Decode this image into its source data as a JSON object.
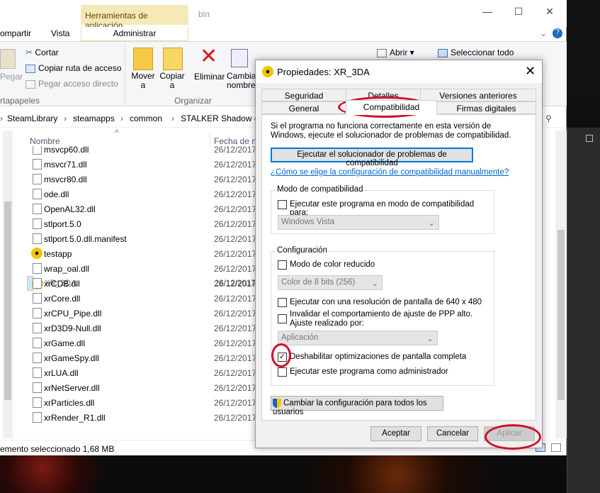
{
  "explorer": {
    "context_tab": "Herramientas de aplicación",
    "title": "bin",
    "ribbon_tabs": [
      "ompartir",
      "Vista",
      "Administrar"
    ],
    "ribbon": {
      "paste": "Pegar",
      "cut": "Cortar",
      "copy_path": "Copiar ruta de acceso",
      "paste_shortcut": "Pegar acceso directo",
      "clipboard_group": "rtapapeles",
      "move": "Mover a",
      "copy": "Copiar a",
      "delete": "Eliminar",
      "rename": "Cambiar nombre",
      "organize_group": "Organizar",
      "open": "Abrir",
      "select_all": "Seleccionar todo"
    },
    "breadcrumbs": [
      "SteamLibrary",
      "steamapps",
      "common",
      "STALKER Shadow of"
    ],
    "columns": {
      "name": "Nombre",
      "date": "Fecha de m"
    },
    "files": [
      {
        "name": "msvcp60.dll",
        "date": "26/12/2017",
        "icon": "dll"
      },
      {
        "name": "msvcr71.dll",
        "date": "26/12/2017",
        "icon": "dll"
      },
      {
        "name": "msvcr80.dll",
        "date": "26/12/2017",
        "icon": "dll"
      },
      {
        "name": "ode.dll",
        "date": "26/12/2017",
        "icon": "dll"
      },
      {
        "name": "OpenAL32.dll",
        "date": "26/12/2017",
        "icon": "dll"
      },
      {
        "name": "stlport.5.0",
        "date": "26/12/2017",
        "icon": "dll"
      },
      {
        "name": "stlport.5.0.dll.manifest",
        "date": "26/12/2017",
        "icon": "file"
      },
      {
        "name": "testapp",
        "date": "26/12/2017",
        "icon": "radiation"
      },
      {
        "name": "wrap_oal.dll",
        "date": "26/12/2017",
        "icon": "dll"
      },
      {
        "name": "XR_3DA",
        "date": "26/12/2017",
        "icon": "radiation"
      },
      {
        "name": "xrCDB.dll",
        "date": "26/12/2017",
        "icon": "dll"
      },
      {
        "name": "xrCore.dll",
        "date": "26/12/2017",
        "icon": "dll"
      },
      {
        "name": "xrCPU_Pipe.dll",
        "date": "26/12/2017",
        "icon": "dll"
      },
      {
        "name": "xrD3D9-Null.dll",
        "date": "26/12/2017",
        "icon": "dll"
      },
      {
        "name": "xrGame.dll",
        "date": "26/12/2017",
        "icon": "dll"
      },
      {
        "name": "xrGameSpy.dll",
        "date": "26/12/2017",
        "icon": "dll"
      },
      {
        "name": "xrLUA.dll",
        "date": "26/12/2017",
        "icon": "dll"
      },
      {
        "name": "xrNetServer.dll",
        "date": "26/12/2017",
        "icon": "dll"
      },
      {
        "name": "xrParticles.dll",
        "date": "26/12/2017",
        "icon": "dll"
      },
      {
        "name": "xrRender_R1.dll",
        "date": "26/12/2017",
        "icon": "dll"
      }
    ],
    "selected_file": "XR_3DA",
    "status": "emento seleccionado  1,68 MB"
  },
  "dialog": {
    "title": "Propiedades: XR_3DA",
    "tabs_row1": [
      "Seguridad",
      "Detalles",
      "Versiones anteriores"
    ],
    "tabs_row2": [
      "General",
      "Compatibilidad",
      "Firmas digitales"
    ],
    "active_tab": "Compatibilidad",
    "intro": "Si el programa no funciona correctamente en esta versión de Windows, ejecute el solucionador de problemas de compatibilidad.",
    "troubleshooter_button": "Ejecutar el solucionador de problemas de compatibilidad",
    "manual_link": "¿Cómo se elige la configuración de compatibilidad manualmente?",
    "compat_mode": {
      "legend": "Modo de compatibilidad",
      "checkbox": "Ejecutar este programa en modo de compatibilidad para:",
      "checked": false,
      "select_value": "Windows Vista"
    },
    "settings": {
      "legend": "Configuración",
      "reduced_color": "Modo de color reducido",
      "reduced_color_checked": false,
      "color_select": "Color de 8 bits (256)",
      "res_640": "Ejecutar con una resolución de pantalla de 640 x 480",
      "res_640_checked": false,
      "dpi_override_line1": "Invalidar el comportamiento de ajuste de PPP alto.",
      "dpi_override_line2": "Ajuste realizado por:",
      "dpi_checked": false,
      "dpi_select": "Aplicación",
      "disable_fullscreen_opt": "Deshabilitar optimizaciones de pantalla completa",
      "disable_fullscreen_opt_checked": true,
      "run_as_admin": "Ejecutar este programa como administrador",
      "run_as_admin_checked": false
    },
    "all_users_button": "Cambiar la configuración para todos los usuarios",
    "ok": "Aceptar",
    "cancel": "Cancelar",
    "apply": "Aplicar"
  },
  "colors": {
    "annotation_red": "#d0102a",
    "context_tab": "#f5e9b8",
    "selection": "#cce8ff",
    "link": "#0066cc"
  }
}
